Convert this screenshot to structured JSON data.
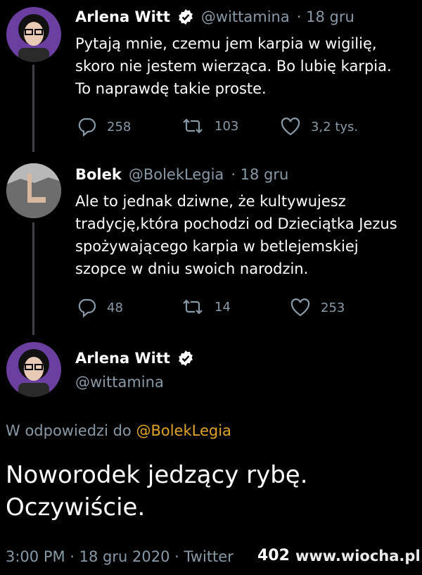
{
  "tweet1": {
    "name": "Arlena Witt",
    "handle": "@wittamina",
    "date": "· 18 gru",
    "text": "Pytają mnie, czemu jem karpia w wigilię,\nskoro nie jestem wierząca. Bo lubię karpia.\nTo naprawdę takie proste.",
    "replies": "258",
    "retweets": "103",
    "likes": "3,2 tys."
  },
  "tweet2": {
    "name": "Bolek",
    "handle": "@BolekLegia",
    "date": "· 18 gru",
    "text": "Ale to jednak dziwne, że kultywujesz\ntradycję,która pochodzi od Dzieciątka Jezus\nspożywającego karpia w betlejemskiej\nszopce w dniu swoich narodzin.",
    "replies": "48",
    "retweets": "14",
    "likes": "253"
  },
  "tweet3": {
    "name": "Arlena Witt",
    "handle": "@wittamina",
    "reply_prefix": "W odpowiedzi do",
    "reply_to": "@BolekLegia",
    "text": "Noworodek jedzący rybę.\nOczywiście.",
    "timestamp": "3:00 PM · 18 gru 2020 · Twitter",
    "retweet_count": "402"
  },
  "watermark": "www.wiocha.pl",
  "colors": {
    "background": "#000000",
    "secondary_text": "#8899a6",
    "link": "#e0a528",
    "thread_line": "#3d4349"
  },
  "icons": [
    "verified-badge-icon",
    "reply-icon",
    "retweet-icon",
    "like-icon"
  ]
}
